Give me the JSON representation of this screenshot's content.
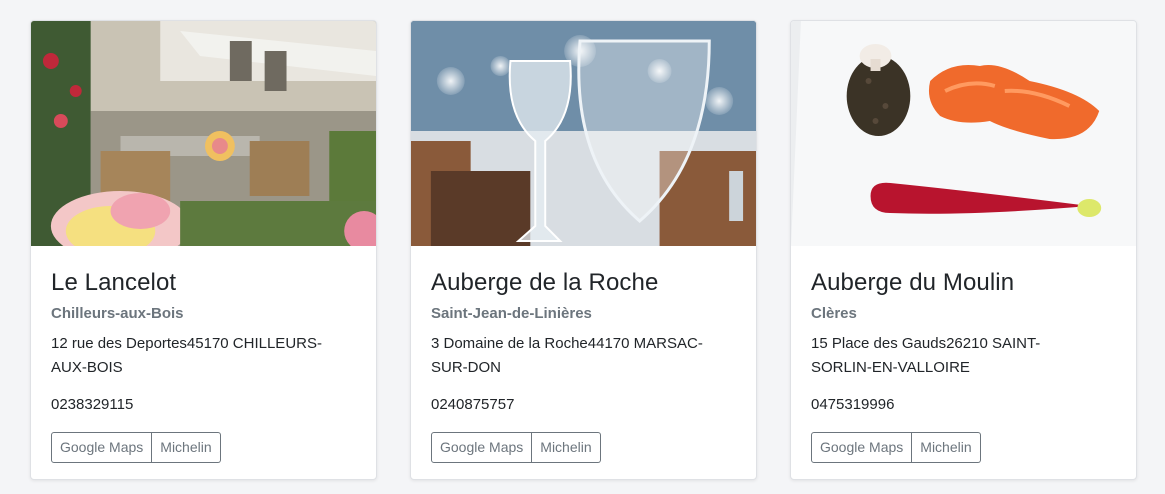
{
  "restaurants": [
    {
      "name": "Le Lancelot",
      "city": "Chilleurs-aux-Bois",
      "address": "12 rue des Deportes45170 CHILLEURS-AUX-BOIS",
      "phone": "0238329115",
      "maps_label": "Google Maps",
      "michelin_label": "Michelin"
    },
    {
      "name": "Auberge de la Roche",
      "city": "Saint-Jean-de-Linières",
      "address": "3 Domaine de la Roche44170 MARSAC-SUR-DON",
      "phone": "0240875757",
      "maps_label": "Google Maps",
      "michelin_label": "Michelin"
    },
    {
      "name": "Auberge du Moulin",
      "city": "Clères",
      "address": "15 Place des Gauds26210 SAINT-SORLIN-EN-VALLOIRE",
      "phone": "0475319996",
      "maps_label": "Google Maps",
      "michelin_label": "Michelin"
    }
  ]
}
